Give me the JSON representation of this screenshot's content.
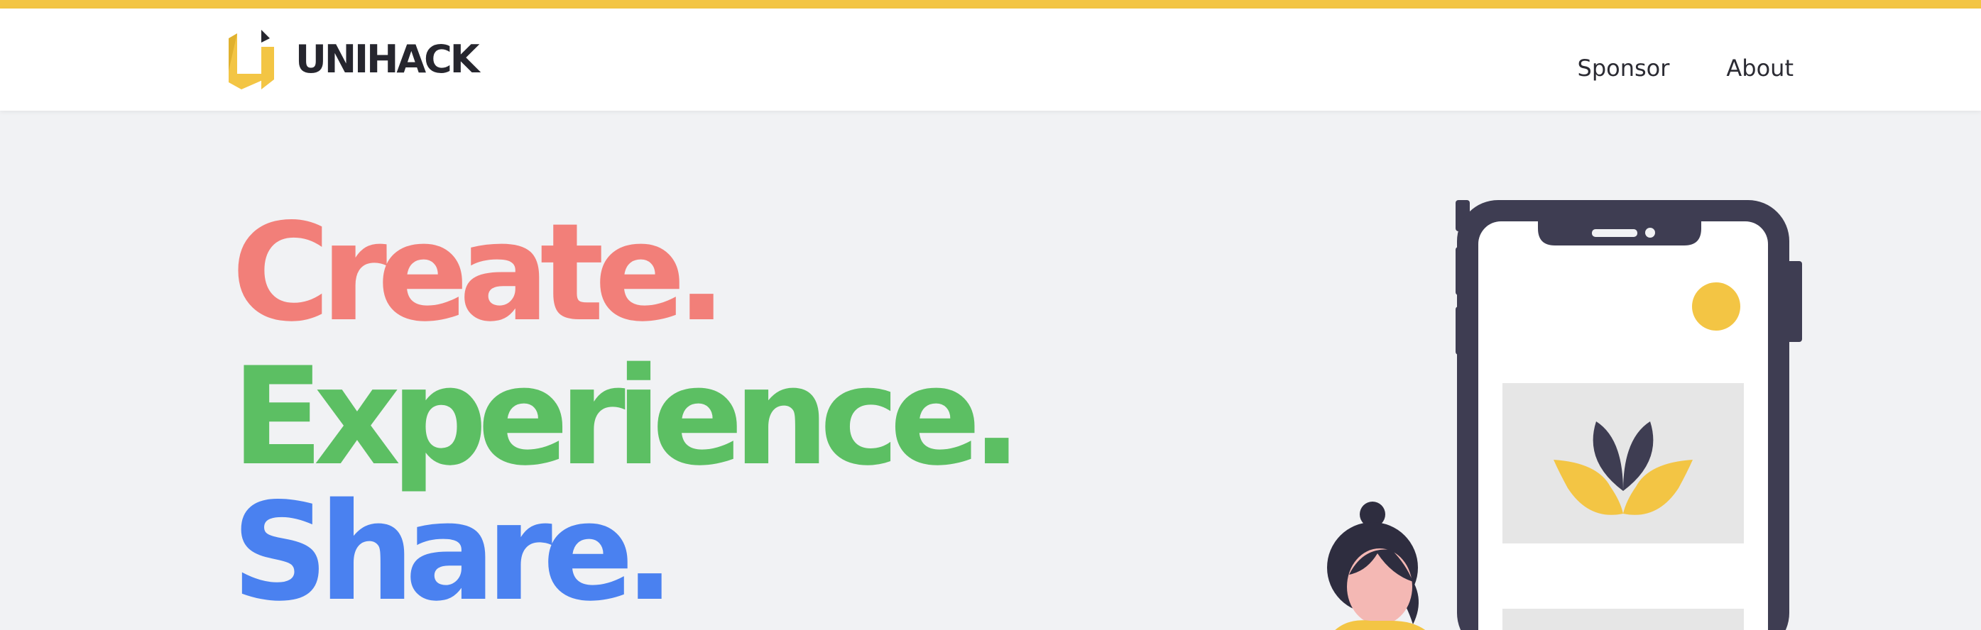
{
  "header": {
    "brand": "UNIHACK",
    "nav": [
      {
        "label": "Sponsor"
      },
      {
        "label": "About"
      }
    ]
  },
  "hero": {
    "lines": [
      "Create.",
      "Experience.",
      "Share."
    ]
  },
  "colors": {
    "accent": "#f3c544",
    "create": "#f27f79",
    "experience": "#5cbf63",
    "share": "#4a81f0",
    "dark": "#3e3d52"
  },
  "icons": [
    "unihack-logo-icon",
    "phone-illustration",
    "lotus-icon",
    "person-illustration"
  ]
}
